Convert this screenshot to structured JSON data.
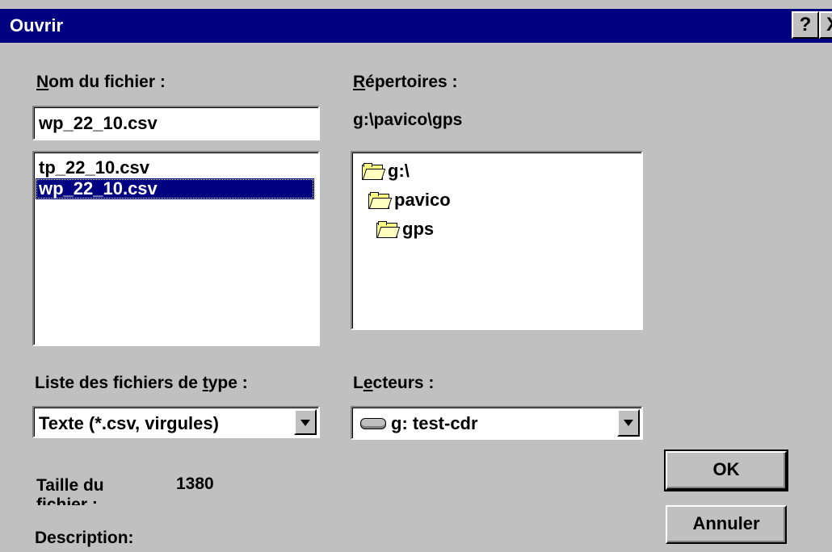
{
  "window": {
    "title": "Ouvrir",
    "help_glyph": "?",
    "close_glyph": "X"
  },
  "filename": {
    "label_accel": "N",
    "label_rest": "om du fichier :",
    "value": "wp_22_10.csv"
  },
  "files": [
    {
      "name": "tp_22_10.csv",
      "selected": false
    },
    {
      "name": "wp_22_10.csv",
      "selected": true
    }
  ],
  "directories": {
    "label_accel": "R",
    "label_rest": "épertoires :",
    "current_path": "g:\\pavico\\gps",
    "tree": [
      {
        "name": "g:\\",
        "icon": "open-folder-icon"
      },
      {
        "name": "pavico",
        "icon": "open-folder-icon"
      },
      {
        "name": "gps",
        "icon": "open-folder-icon"
      }
    ]
  },
  "filetype": {
    "label_pre": "Liste des fichiers de ",
    "label_accel": "t",
    "label_post": "ype :",
    "value": "Texte (*.csv, virgules)"
  },
  "drives": {
    "label_pre": "L",
    "label_accel": "e",
    "label_post": "cteurs :",
    "value": "g: test-cdr",
    "icon": "drive-icon"
  },
  "filesize": {
    "label": "Taille du fichier :",
    "value": "1380"
  },
  "description": {
    "label": "Description:"
  },
  "buttons": {
    "ok": "OK",
    "cancel": "Annuler"
  }
}
